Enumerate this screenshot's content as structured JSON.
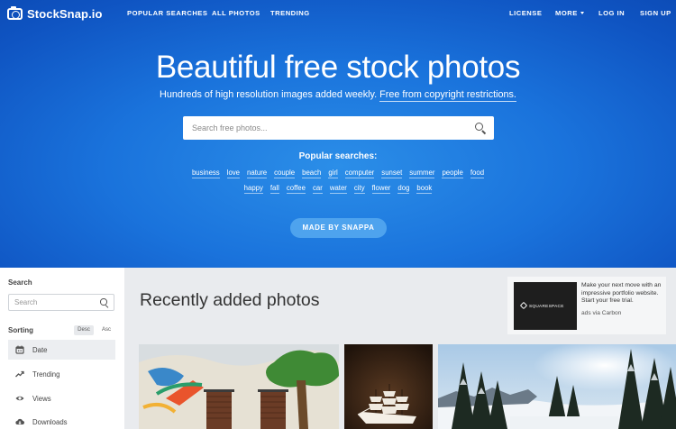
{
  "nav": {
    "logo": "StockSnap.io",
    "left_links": [
      "POPULAR SEARCHES",
      "ALL PHOTOS",
      "TRENDING"
    ],
    "right_links": [
      "LICENSE",
      "MORE",
      "LOG IN",
      "SIGN UP"
    ]
  },
  "hero": {
    "title": "Beautiful free stock photos",
    "subtitle": "Hundreds of high resolution images added weekly.",
    "subtitle_link": "Free from copyright restrictions.",
    "search_placeholder": "Search free photos...",
    "popular_title": "Popular searches:",
    "tags_row1": [
      "business",
      "love",
      "nature",
      "couple",
      "beach",
      "girl",
      "computer",
      "sunset",
      "summer",
      "people",
      "food"
    ],
    "tags_row2": [
      "happy",
      "fall",
      "coffee",
      "car",
      "water",
      "city",
      "flower",
      "dog",
      "book"
    ],
    "cta": "MADE BY SNAPPA"
  },
  "sidebar": {
    "search_label": "Search",
    "search_placeholder": "Search",
    "sorting_label": "Sorting",
    "sort_desc": "Desc",
    "sort_asc": "Asc",
    "items": [
      {
        "label": "Date",
        "icon": "calendar-icon",
        "active": true
      },
      {
        "label": "Trending",
        "icon": "trending-icon",
        "active": false
      },
      {
        "label": "Views",
        "icon": "eye-icon",
        "active": false
      },
      {
        "label": "Downloads",
        "icon": "cloud-download-icon",
        "active": false
      }
    ]
  },
  "main": {
    "title": "Recently added photos"
  },
  "ad": {
    "brand": "SQUARESPACE",
    "text": "Make your next move with an impressive portfolio website. Start your free trial.",
    "via": "ads via Carbon"
  },
  "colors": {
    "hero_blue": "#1a73dc",
    "cta_blue": "#4ea3ee",
    "page_bg": "#e9ebee"
  }
}
